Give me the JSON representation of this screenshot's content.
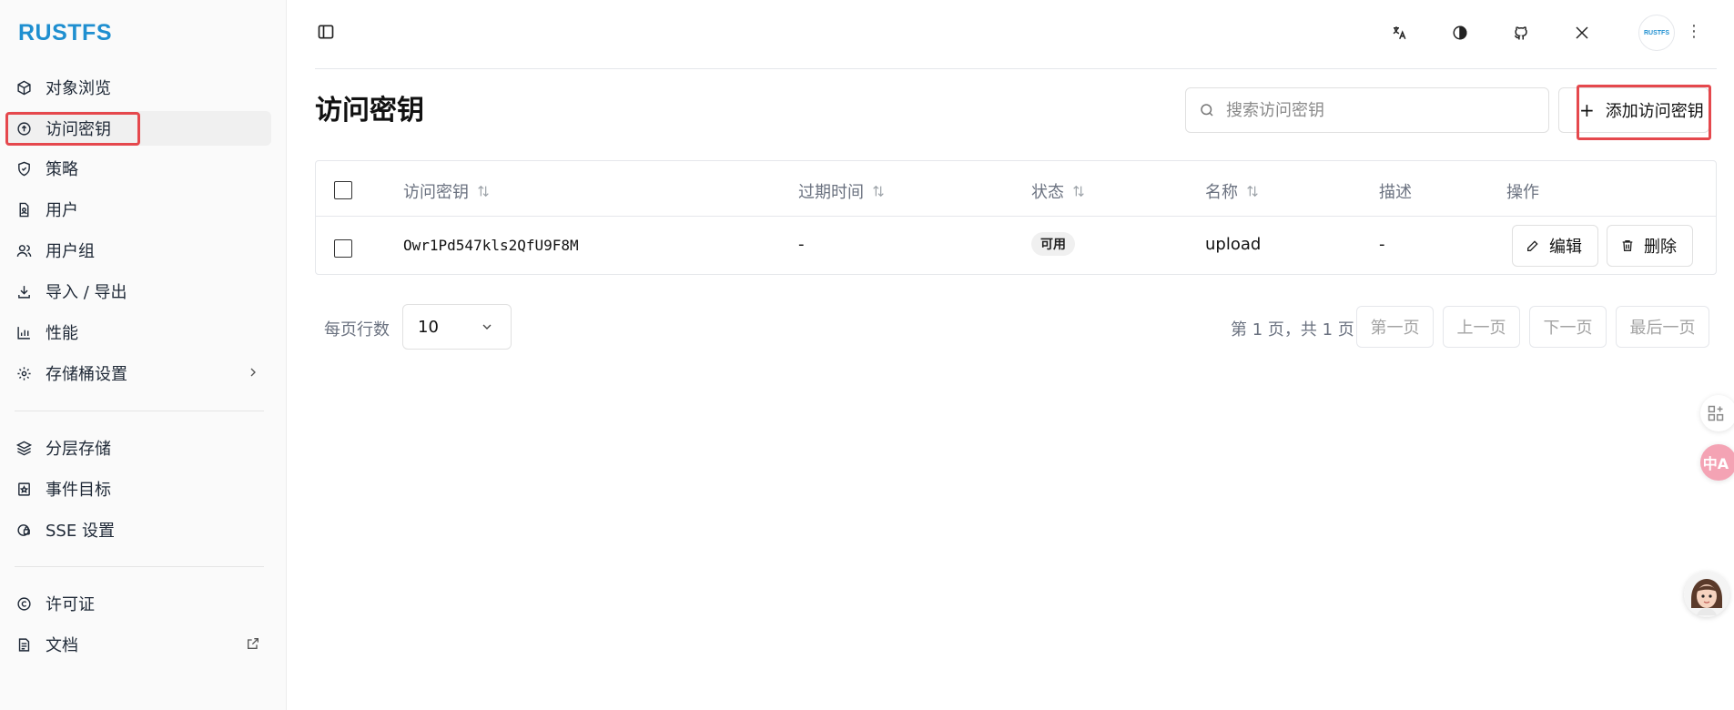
{
  "brand": {
    "logo_text": "RUSTFS",
    "avatar_text": "RUSTFS",
    "accent_color": "#1f8fd0"
  },
  "sidebar": {
    "items": [
      {
        "label": "对象浏览",
        "icon": "cube-icon"
      },
      {
        "label": "访问密钥",
        "icon": "key-circle-icon",
        "active": true
      },
      {
        "label": "策略",
        "icon": "shield-icon"
      },
      {
        "label": "用户",
        "icon": "user-file-icon"
      },
      {
        "label": "用户组",
        "icon": "users-icon"
      },
      {
        "label": "导入 / 导出",
        "icon": "download-icon"
      },
      {
        "label": "性能",
        "icon": "bar-chart-icon"
      },
      {
        "label": "存储桶设置",
        "icon": "gear-icon",
        "trailing": "chevron-right-icon"
      }
    ],
    "items2": [
      {
        "label": "分层存储",
        "icon": "layers-icon"
      },
      {
        "label": "事件目标",
        "icon": "bookmark-icon"
      },
      {
        "label": "SSE 设置",
        "icon": "shield-lock-icon"
      }
    ],
    "items3": [
      {
        "label": "许可证",
        "icon": "copyright-icon"
      },
      {
        "label": "文档",
        "icon": "document-icon",
        "trailing": "external-link-icon"
      }
    ]
  },
  "header": {
    "icons": [
      "sidebar-toggle-icon",
      "translate-icon",
      "theme-icon",
      "github-icon",
      "x-icon",
      "more-vertical-icon"
    ]
  },
  "page": {
    "title": "访问密钥",
    "search_placeholder": "搜索访问密钥",
    "add_button": "添加访问密钥"
  },
  "table": {
    "columns": [
      "访问密钥",
      "过期时间",
      "状态",
      "名称",
      "描述",
      "操作"
    ],
    "rows": [
      {
        "access_key": "Owr1Pd547kls2QfU9F8M",
        "expiry": "-",
        "status": "可用",
        "name": "upload",
        "description": "-",
        "edit": "编辑",
        "delete": "删除"
      }
    ]
  },
  "pagination": {
    "rows_per_page_label": "每页行数",
    "rows_per_page": "10",
    "page_info": "第 1 页，共 1 页",
    "first": "第一页",
    "prev": "上一页",
    "next": "下一页",
    "last": "最后一页"
  },
  "floating": {
    "translate_badge": "中A"
  },
  "highlight_color": "#e5484d"
}
